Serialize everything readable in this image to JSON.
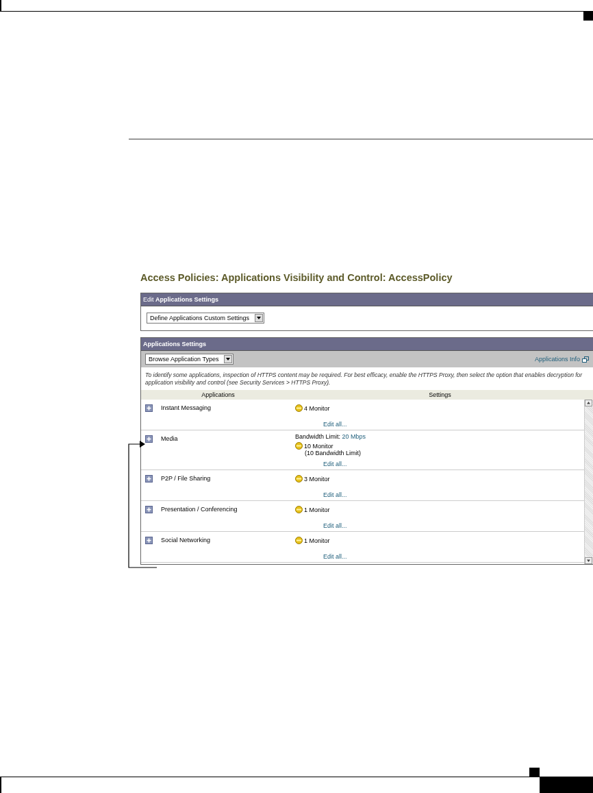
{
  "title": "Access Policies: Applications Visibility and Control: AccessPolicy",
  "edit_panel": {
    "header": "Edit **Applications Settings**",
    "dropdown": "Define Applications Custom Settings"
  },
  "settings_panel": {
    "header": "Applications Settings",
    "dropdown": "Browse Application Types",
    "info_link": "Applications Info",
    "note": "To identify some applications, inspection of HTTPS content may be required. For best efficacy, enable the HTTPS Proxy, then select the option that enables decryption for application visibility and control (see Security Services > HTTPS Proxy).",
    "columns": [
      "Applications",
      "Settings"
    ],
    "rows": [
      {
        "name": "Instant Messaging",
        "status": "4 Monitor",
        "edit": "Edit all..."
      },
      {
        "name": "Media",
        "bandwidth_label": "Bandwidth Limit:",
        "bandwidth_value": "20 Mbps",
        "status": "10 Monitor",
        "status_detail": "(10 Bandwidth Limit)",
        "edit": "Edit all..."
      },
      {
        "name": "P2P / File Sharing",
        "status": "3 Monitor",
        "edit": "Edit all..."
      },
      {
        "name": "Presentation / Conferencing",
        "status": "1 Monitor",
        "edit": "Edit all..."
      },
      {
        "name": "Social Networking",
        "status": "1 Monitor",
        "edit": "Edit all..."
      }
    ]
  }
}
